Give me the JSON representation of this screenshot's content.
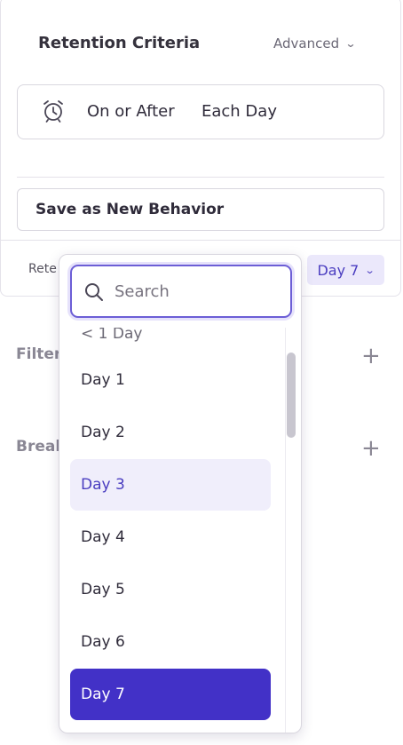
{
  "retention": {
    "title": "Retention Criteria",
    "advanced_label": "Advanced",
    "criteria_mode": "On or After",
    "criteria_unit": "Each Day",
    "save_label": "Save as New Behavior",
    "footer_label": "Rete",
    "day_selected": "Day 7"
  },
  "sidebar": {
    "filters_label": "Filter",
    "breakdown_label": "Break"
  },
  "dropdown": {
    "search_placeholder": "Search",
    "partial_item": "< 1 Day",
    "items": [
      "Day 1",
      "Day 2",
      "Day 3",
      "Day 4",
      "Day 5",
      "Day 6",
      "Day 7"
    ],
    "hover_item": "Day 3",
    "selected_item": "Day 7"
  },
  "colors": {
    "accent": "#4231c7",
    "accent_light": "#ebe8fb",
    "hover": "#f0eefb"
  }
}
